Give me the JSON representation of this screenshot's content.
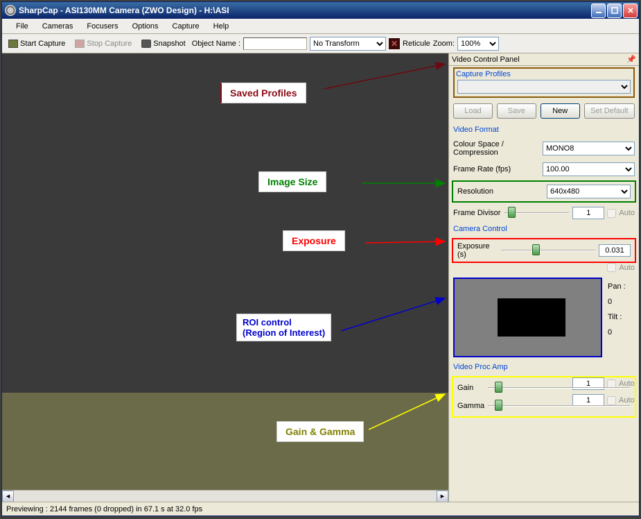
{
  "window": {
    "title": "SharpCap - ASI130MM Camera (ZWO Design) - H:\\ASI"
  },
  "menubar": [
    "File",
    "Cameras",
    "Focusers",
    "Options",
    "Capture",
    "Help"
  ],
  "toolbar": {
    "start_capture": "Start Capture",
    "stop_capture": "Stop Capture",
    "snapshot": "Snapshot",
    "object_name_label": "Object Name :",
    "object_name_value": "",
    "transform_value": "No Transform",
    "reticule_label": "Reticule",
    "zoom_label": "Zoom:",
    "zoom_value": "100%"
  },
  "annotations": {
    "saved_profiles": "Saved Profiles",
    "image_size": "Image Size",
    "exposure": "Exposure",
    "roi": "ROI control\n(Region of Interest)",
    "gain_gamma": "Gain & Gamma"
  },
  "panel": {
    "title": "Video Control Panel",
    "capture_profiles": {
      "title": "Capture Profiles",
      "value": "",
      "load": "Load",
      "save": "Save",
      "new": "New",
      "set_default": "Set Default"
    },
    "video_format": {
      "title": "Video Format",
      "color_space_label": "Colour Space / Compression",
      "color_space_value": "MONO8",
      "frame_rate_label": "Frame Rate (fps)",
      "frame_rate_value": "100.00",
      "resolution_label": "Resolution",
      "resolution_value": "640x480",
      "frame_divisor_label": "Frame Divisor",
      "frame_divisor_value": "1",
      "auto": "Auto"
    },
    "camera_control": {
      "title": "Camera Control",
      "exposure_label": "Exposure (s)",
      "exposure_value": "0.031",
      "auto": "Auto",
      "pan_label": "Pan :",
      "pan_value": "0",
      "tilt_label": "Tilt :",
      "tilt_value": "0"
    },
    "video_proc_amp": {
      "title": "Video Proc Amp",
      "gain_label": "Gain",
      "gain_value": "1",
      "gamma_label": "Gamma",
      "gamma_value": "1",
      "auto": "Auto"
    }
  },
  "statusbar": {
    "text": "Previewing : 2144 frames (0 dropped) in 67.1 s at 32.0 fps"
  }
}
